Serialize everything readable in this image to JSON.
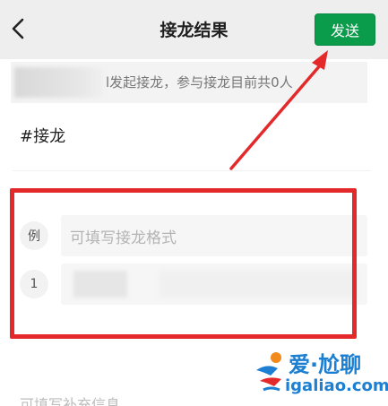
{
  "header": {
    "title": "接龙结果",
    "send_label": "发送"
  },
  "initiator": {
    "text": "l发起接龙，参与接龙目前共0人"
  },
  "tag": "#接龙",
  "rows": {
    "example_badge": "例",
    "example_placeholder": "可填写接龙格式",
    "first_badge": "1"
  },
  "supplementary_placeholder": "可填写补充信息",
  "watermark": {
    "cn": "爱·尬聊",
    "site": "igaliao.com"
  },
  "colors": {
    "send_button": "#0b9c4b",
    "annotation": "#e4292a",
    "watermark": "#1d7fd1"
  },
  "icons": {
    "back": "chevron-left-icon"
  }
}
